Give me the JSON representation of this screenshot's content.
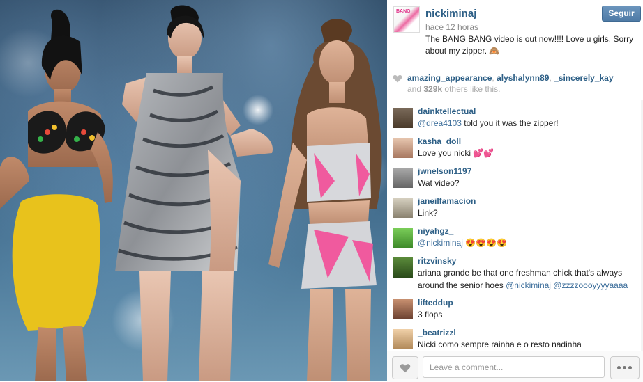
{
  "post": {
    "username": "nickiminaj",
    "time": "hace 12 horas",
    "caption": "The BANG BANG video is out now!!!! Love u girls. Sorry about my zipper. 🙈",
    "follow_label": "Seguir",
    "avatar_text": "BANG"
  },
  "likes": {
    "users": [
      "amazing_appearance",
      "alyshalynn89",
      "_sincerely_kay"
    ],
    "sep1": ", ",
    "sep2": ", ",
    "and_text": "and ",
    "count": "329k",
    "suffix": " others like this."
  },
  "comments": [
    {
      "user": "dainktellectual",
      "mention": "@drea4103",
      "text": " told you it was the zipper!",
      "avatar_color": "#5a4a3a"
    },
    {
      "user": "kasha_doll",
      "mention": "",
      "text": "Love you nicki 💕💕",
      "avatar_color": "#c9a186"
    },
    {
      "user": "jwnelson1197",
      "mention": "",
      "text": "Wat video?",
      "avatar_color": "#8a8a8a"
    },
    {
      "user": "janeilfamacion",
      "mention": "",
      "text": "Link?",
      "avatar_color": "#b8b0a0"
    },
    {
      "user": "niyahgz_",
      "mention": "@nickiminaj",
      "text": " 😍😍😍😍",
      "avatar_color": "#6ab04c"
    },
    {
      "user": "ritzvinsky",
      "mention": "",
      "text": "ariana grande be that one freshman chick that's always around the senior hoes ",
      "mentions_after": "@nickiminaj @zzzzoooyyyyaaaa",
      "avatar_color": "#3a6b2a"
    },
    {
      "user": "lifteddup",
      "mention": "",
      "text": "3 flops",
      "avatar_color": "#a07050"
    },
    {
      "user": "_beatrizzl",
      "mention": "",
      "text": "Nicki como sempre rainha e o resto nadinha",
      "avatar_color": "#d4b08a"
    }
  ],
  "footer": {
    "comment_placeholder": "Leave a comment...",
    "like_icon": "heart-icon",
    "more_icon": "ellipsis-icon"
  },
  "colors": {
    "link": "#2d5f86",
    "follow_button": "#5b86b0"
  }
}
